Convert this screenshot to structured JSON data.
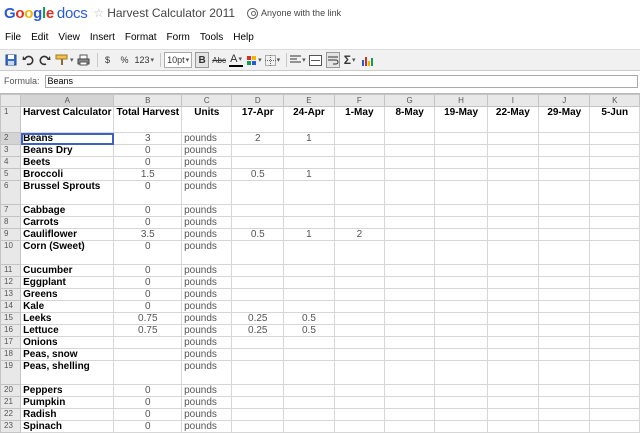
{
  "header": {
    "app_name_letters": [
      "G",
      "o",
      "o",
      "g",
      "l",
      "e"
    ],
    "app_suffix": "docs",
    "doc_title": "Harvest Calculator 2011",
    "share_text": "Anyone with the link"
  },
  "menu": [
    "File",
    "Edit",
    "View",
    "Insert",
    "Format",
    "Form",
    "Tools",
    "Help"
  ],
  "toolbar": {
    "currency": "$",
    "percent": "%",
    "number_format": "123",
    "font_size": "10pt",
    "bold": "B",
    "strikethrough": "Abc",
    "text_color": "A",
    "sum": "Σ"
  },
  "formula_bar": {
    "label": "Formula:",
    "value": "Beans"
  },
  "grid": {
    "columns": [
      "A",
      "B",
      "C",
      "D",
      "E",
      "F",
      "G",
      "H",
      "I",
      "J",
      "K"
    ],
    "header_row": [
      "Harvest Calculator",
      "Total Harvest",
      "Units",
      "17-Apr",
      "24-Apr",
      "1-May",
      "8-May",
      "19-May",
      "22-May",
      "29-May",
      "5-Jun"
    ],
    "rows": [
      {
        "n": "2",
        "cells": [
          "Beans",
          "3",
          "pounds",
          "2",
          "1",
          "",
          "",
          "",
          "",
          "",
          ""
        ]
      },
      {
        "n": "3",
        "cells": [
          "Beans Dry",
          "0",
          "pounds",
          "",
          "",
          "",
          "",
          "",
          "",
          "",
          ""
        ]
      },
      {
        "n": "4",
        "cells": [
          "Beets",
          "0",
          "pounds",
          "",
          "",
          "",
          "",
          "",
          "",
          "",
          ""
        ]
      },
      {
        "n": "5",
        "cells": [
          "Broccoli",
          "1.5",
          "pounds",
          "0.5",
          "1",
          "",
          "",
          "",
          "",
          "",
          ""
        ]
      },
      {
        "n": "6",
        "cells": [
          "Brussel Sprouts",
          "0",
          "pounds",
          "",
          "",
          "",
          "",
          "",
          "",
          "",
          ""
        ]
      },
      {
        "n": "7",
        "cells": [
          "Cabbage",
          "0",
          "pounds",
          "",
          "",
          "",
          "",
          "",
          "",
          "",
          ""
        ]
      },
      {
        "n": "8",
        "cells": [
          "Carrots",
          "0",
          "pounds",
          "",
          "",
          "",
          "",
          "",
          "",
          "",
          ""
        ]
      },
      {
        "n": "9",
        "cells": [
          "Cauliflower",
          "3.5",
          "pounds",
          "0.5",
          "1",
          "2",
          "",
          "",
          "",
          "",
          ""
        ]
      },
      {
        "n": "10",
        "cells": [
          "Corn (Sweet)",
          "0",
          "pounds",
          "",
          "",
          "",
          "",
          "",
          "",
          "",
          ""
        ]
      },
      {
        "n": "11",
        "cells": [
          "Cucumber",
          "0",
          "pounds",
          "",
          "",
          "",
          "",
          "",
          "",
          "",
          ""
        ]
      },
      {
        "n": "12",
        "cells": [
          "Eggplant",
          "0",
          "pounds",
          "",
          "",
          "",
          "",
          "",
          "",
          "",
          ""
        ]
      },
      {
        "n": "13",
        "cells": [
          "Greens",
          "0",
          "pounds",
          "",
          "",
          "",
          "",
          "",
          "",
          "",
          ""
        ]
      },
      {
        "n": "14",
        "cells": [
          "Kale",
          "0",
          "pounds",
          "",
          "",
          "",
          "",
          "",
          "",
          "",
          ""
        ]
      },
      {
        "n": "15",
        "cells": [
          "Leeks",
          "0.75",
          "pounds",
          "0.25",
          "0.5",
          "",
          "",
          "",
          "",
          "",
          ""
        ]
      },
      {
        "n": "16",
        "cells": [
          "Lettuce",
          "0.75",
          "pounds",
          "0.25",
          "0.5",
          "",
          "",
          "",
          "",
          "",
          ""
        ]
      },
      {
        "n": "17",
        "cells": [
          "Onions",
          "",
          "pounds",
          "",
          "",
          "",
          "",
          "",
          "",
          "",
          ""
        ]
      },
      {
        "n": "18",
        "cells": [
          "Peas, snow",
          "",
          "pounds",
          "",
          "",
          "",
          "",
          "",
          "",
          "",
          ""
        ]
      },
      {
        "n": "19",
        "cells": [
          "Peas, shelling",
          "",
          "pounds",
          "",
          "",
          "",
          "",
          "",
          "",
          "",
          ""
        ]
      },
      {
        "n": "20",
        "cells": [
          "Peppers",
          "0",
          "pounds",
          "",
          "",
          "",
          "",
          "",
          "",
          "",
          ""
        ]
      },
      {
        "n": "21",
        "cells": [
          "Pumpkin",
          "0",
          "pounds",
          "",
          "",
          "",
          "",
          "",
          "",
          "",
          ""
        ]
      },
      {
        "n": "22",
        "cells": [
          "Radish",
          "0",
          "pounds",
          "",
          "",
          "",
          "",
          "",
          "",
          "",
          ""
        ]
      },
      {
        "n": "23",
        "cells": [
          "Spinach",
          "0",
          "pounds",
          "",
          "",
          "",
          "",
          "",
          "",
          "",
          ""
        ]
      }
    ]
  }
}
